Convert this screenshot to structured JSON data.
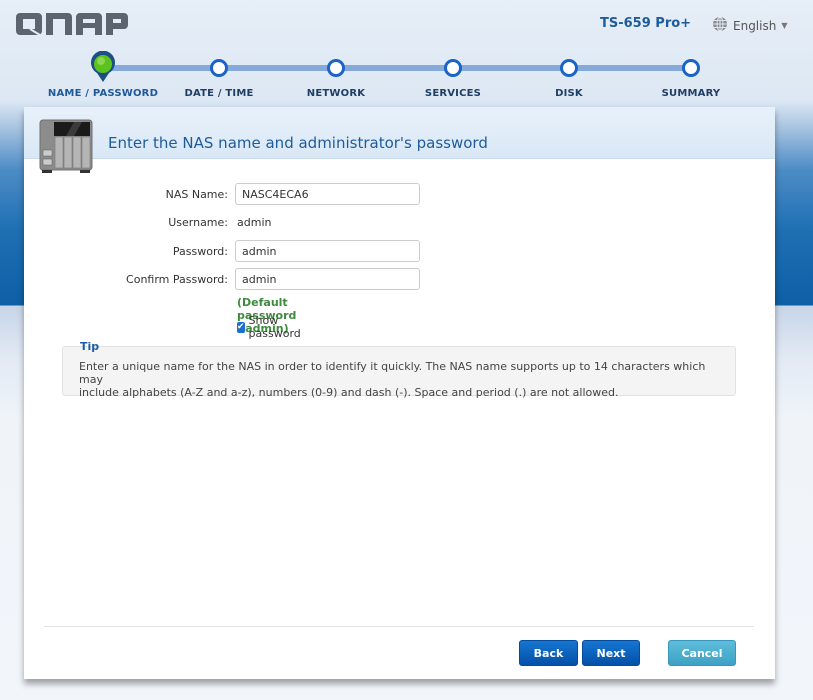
{
  "header": {
    "logo": "QNAP",
    "model": "TS-659 Pro+",
    "language": "English"
  },
  "wizard": {
    "current_step": 0,
    "steps": [
      {
        "label": "NAME / PASSWORD"
      },
      {
        "label": "DATE / TIME"
      },
      {
        "label": "NETWORK"
      },
      {
        "label": "SERVICES"
      },
      {
        "label": "DISK"
      },
      {
        "label": "SUMMARY"
      }
    ]
  },
  "panel": {
    "title": "Enter the NAS name and administrator's password"
  },
  "form": {
    "nas_name_label": "NAS Name:",
    "nas_name_value": "NASC4ECA6",
    "username_label": "Username:",
    "username_value": "admin",
    "password_label": "Password:",
    "password_value": "admin",
    "confirm_label": "Confirm Password:",
    "confirm_value": "admin",
    "default_hint": "(Default password : admin)",
    "show_password_label": "Show password",
    "show_password_checked": true
  },
  "tip": {
    "title": "Tip",
    "text_line1": "Enter a unique name for the NAS in order to identify it quickly. The NAS name supports up to 14 characters which may",
    "text_line2": "include alphabets (A-Z and a-z), numbers (0-9) and dash (-). Space and period (.) are not allowed."
  },
  "buttons": {
    "back": "Back",
    "next": "Next",
    "cancel": "Cancel"
  },
  "colors": {
    "accent": "#1d5c9c",
    "step_ring": "#1b63c7",
    "active_step": "#5cc21e",
    "hint_green": "#3e8a3e",
    "button_blue": "#0a5fb8",
    "button_cancel": "#4aafd0"
  }
}
